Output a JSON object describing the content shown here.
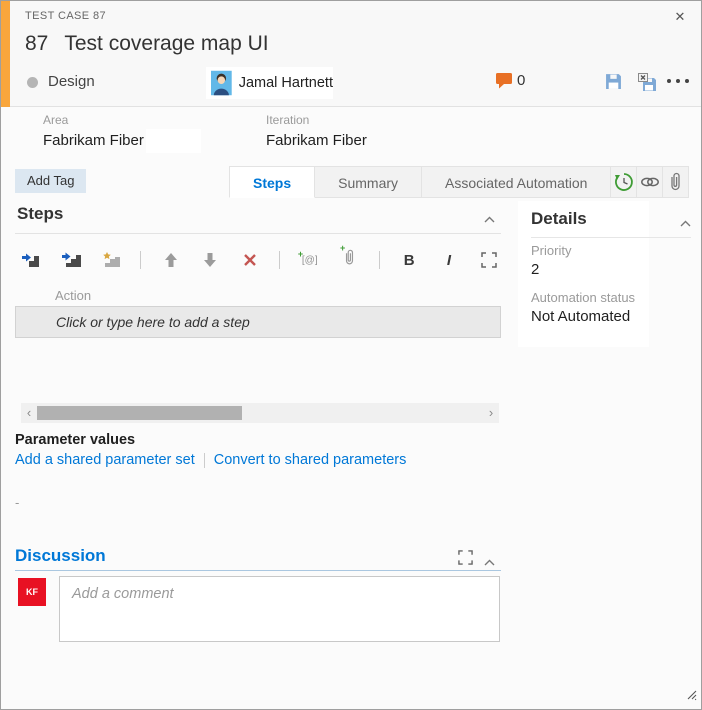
{
  "window": {
    "eyebrow": "TEST CASE 87",
    "close_glyph": "✕"
  },
  "header": {
    "id": "87",
    "title": "Test coverage map UI",
    "state": "Design",
    "assignee": "Jamal Hartnett",
    "comment_count": "0"
  },
  "fields": {
    "area_label": "Area",
    "area_value": "Fabrikam Fiber",
    "iteration_label": "Iteration",
    "iteration_value": "Fabrikam Fiber",
    "add_tag_label": "Add Tag"
  },
  "tabs": [
    {
      "label": "Steps",
      "active": true
    },
    {
      "label": "Summary",
      "active": false
    },
    {
      "label": "Associated Automation",
      "active": false
    }
  ],
  "steps": {
    "title": "Steps",
    "bold_label": "B",
    "italic_label": "I",
    "param_glyph": "[@]",
    "action_header": "Action",
    "add_step_placeholder": "Click or type here to add a step"
  },
  "scrollbar": {
    "left_glyph": "‹",
    "right_glyph": "›"
  },
  "parameters": {
    "title": "Parameter values",
    "link_add": "Add a shared parameter set",
    "link_convert": "Convert to shared parameters",
    "empty_marker": "-"
  },
  "discussion": {
    "title": "Discussion",
    "avatar_initials": "KF",
    "comment_placeholder": "Add a comment"
  },
  "details": {
    "title": "Details",
    "fields": [
      {
        "label": "Priority",
        "value": "2"
      },
      {
        "label": "Automation status",
        "value": "Not Automated"
      }
    ]
  },
  "colors": {
    "accent_blue": "#0078d7",
    "work_item_orange": "#f9a63c",
    "comment_orange": "#e87025",
    "avatar_red": "#e81123",
    "save_blue": "#7fa9d6",
    "delete_red": "#c45652",
    "history_green": "#3f9c35",
    "star_gold": "#d9a741"
  }
}
